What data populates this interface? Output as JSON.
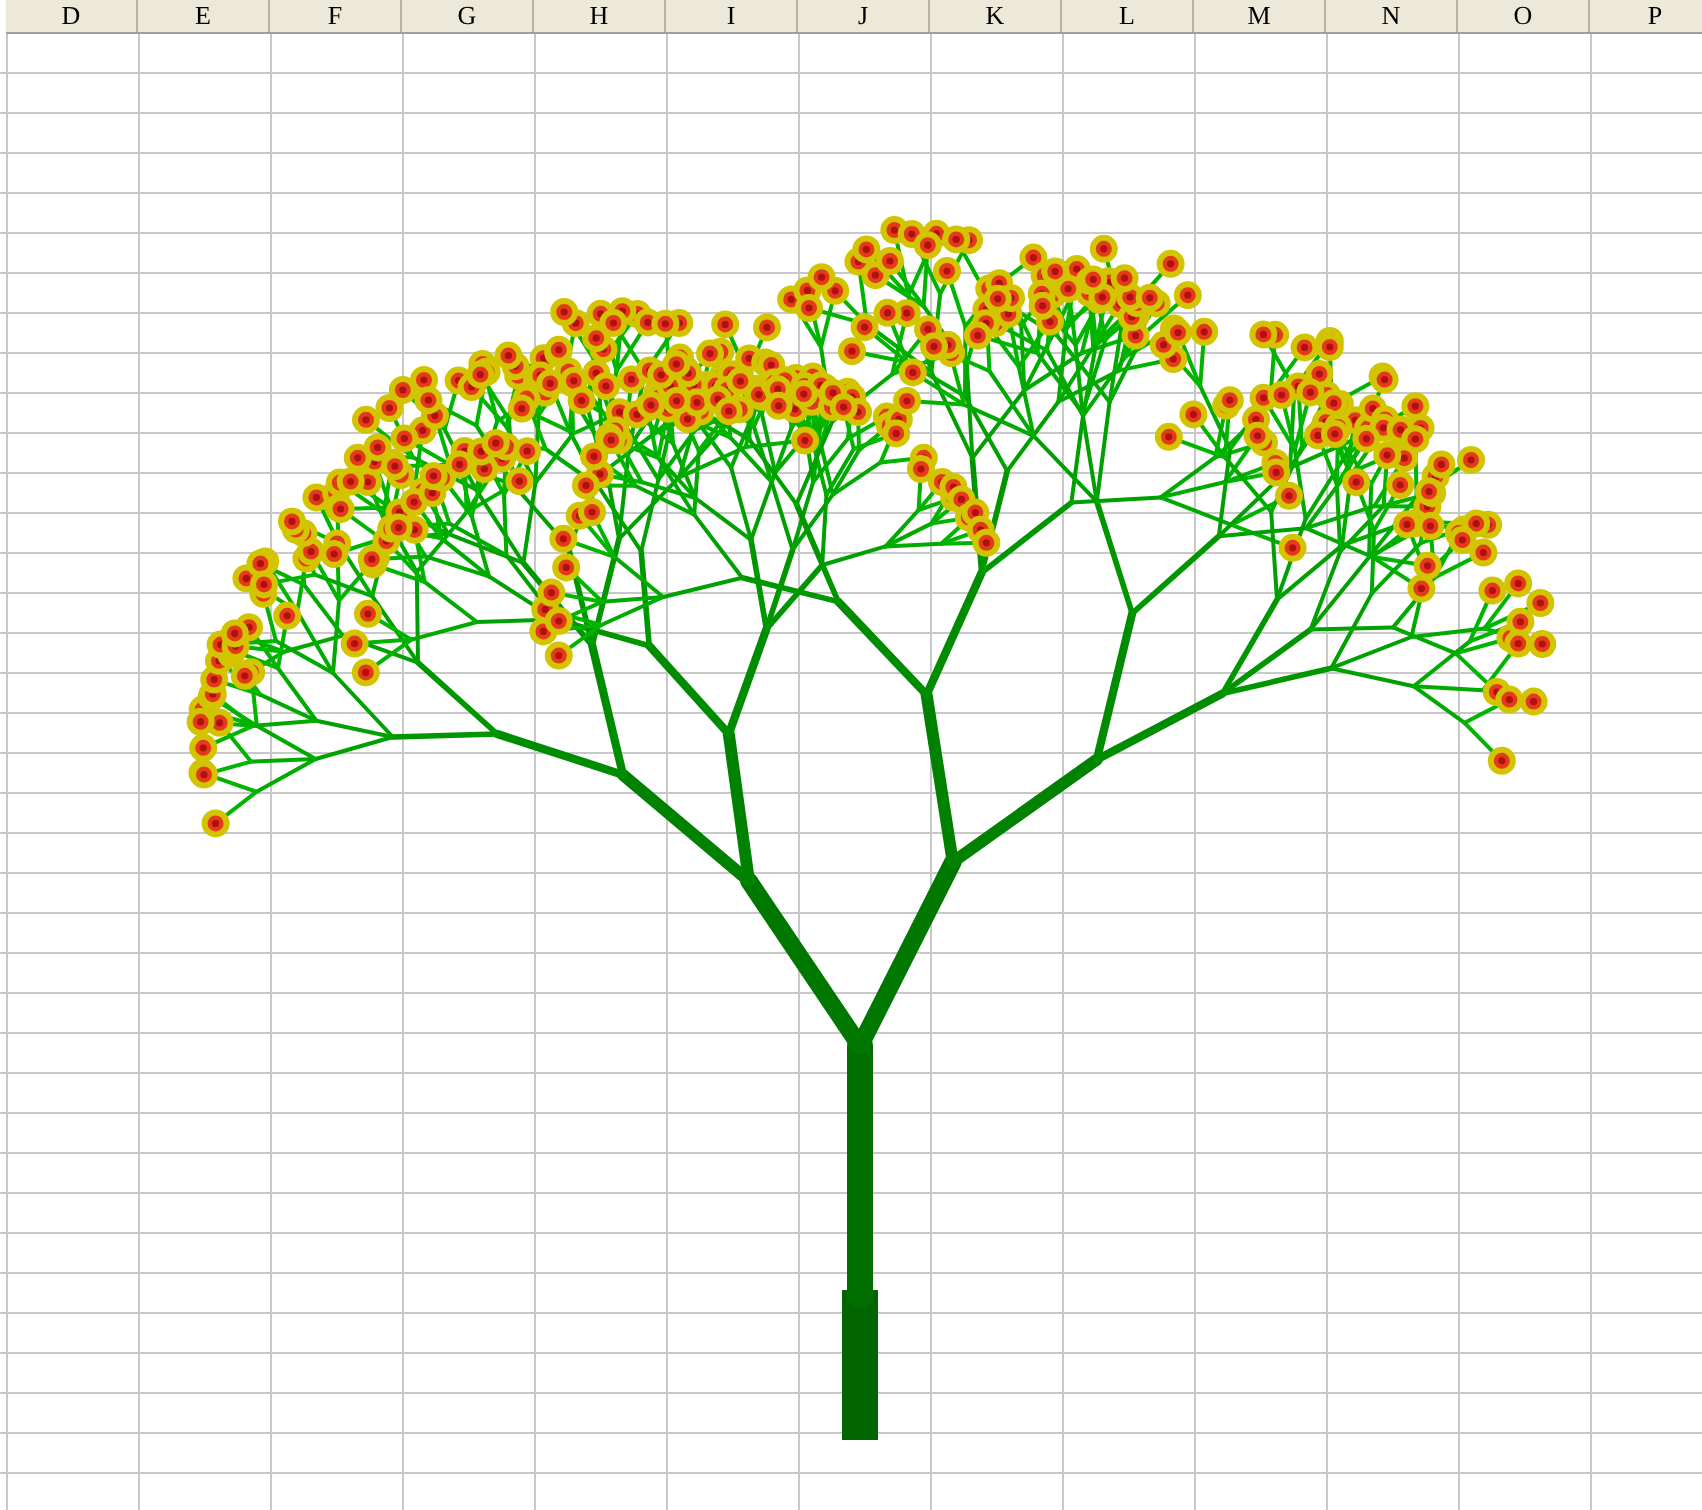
{
  "spreadsheet": {
    "column_headers": [
      "D",
      "E",
      "F",
      "G",
      "H",
      "I",
      "J",
      "K",
      "L",
      "M",
      "N",
      "O",
      "P"
    ]
  }
}
